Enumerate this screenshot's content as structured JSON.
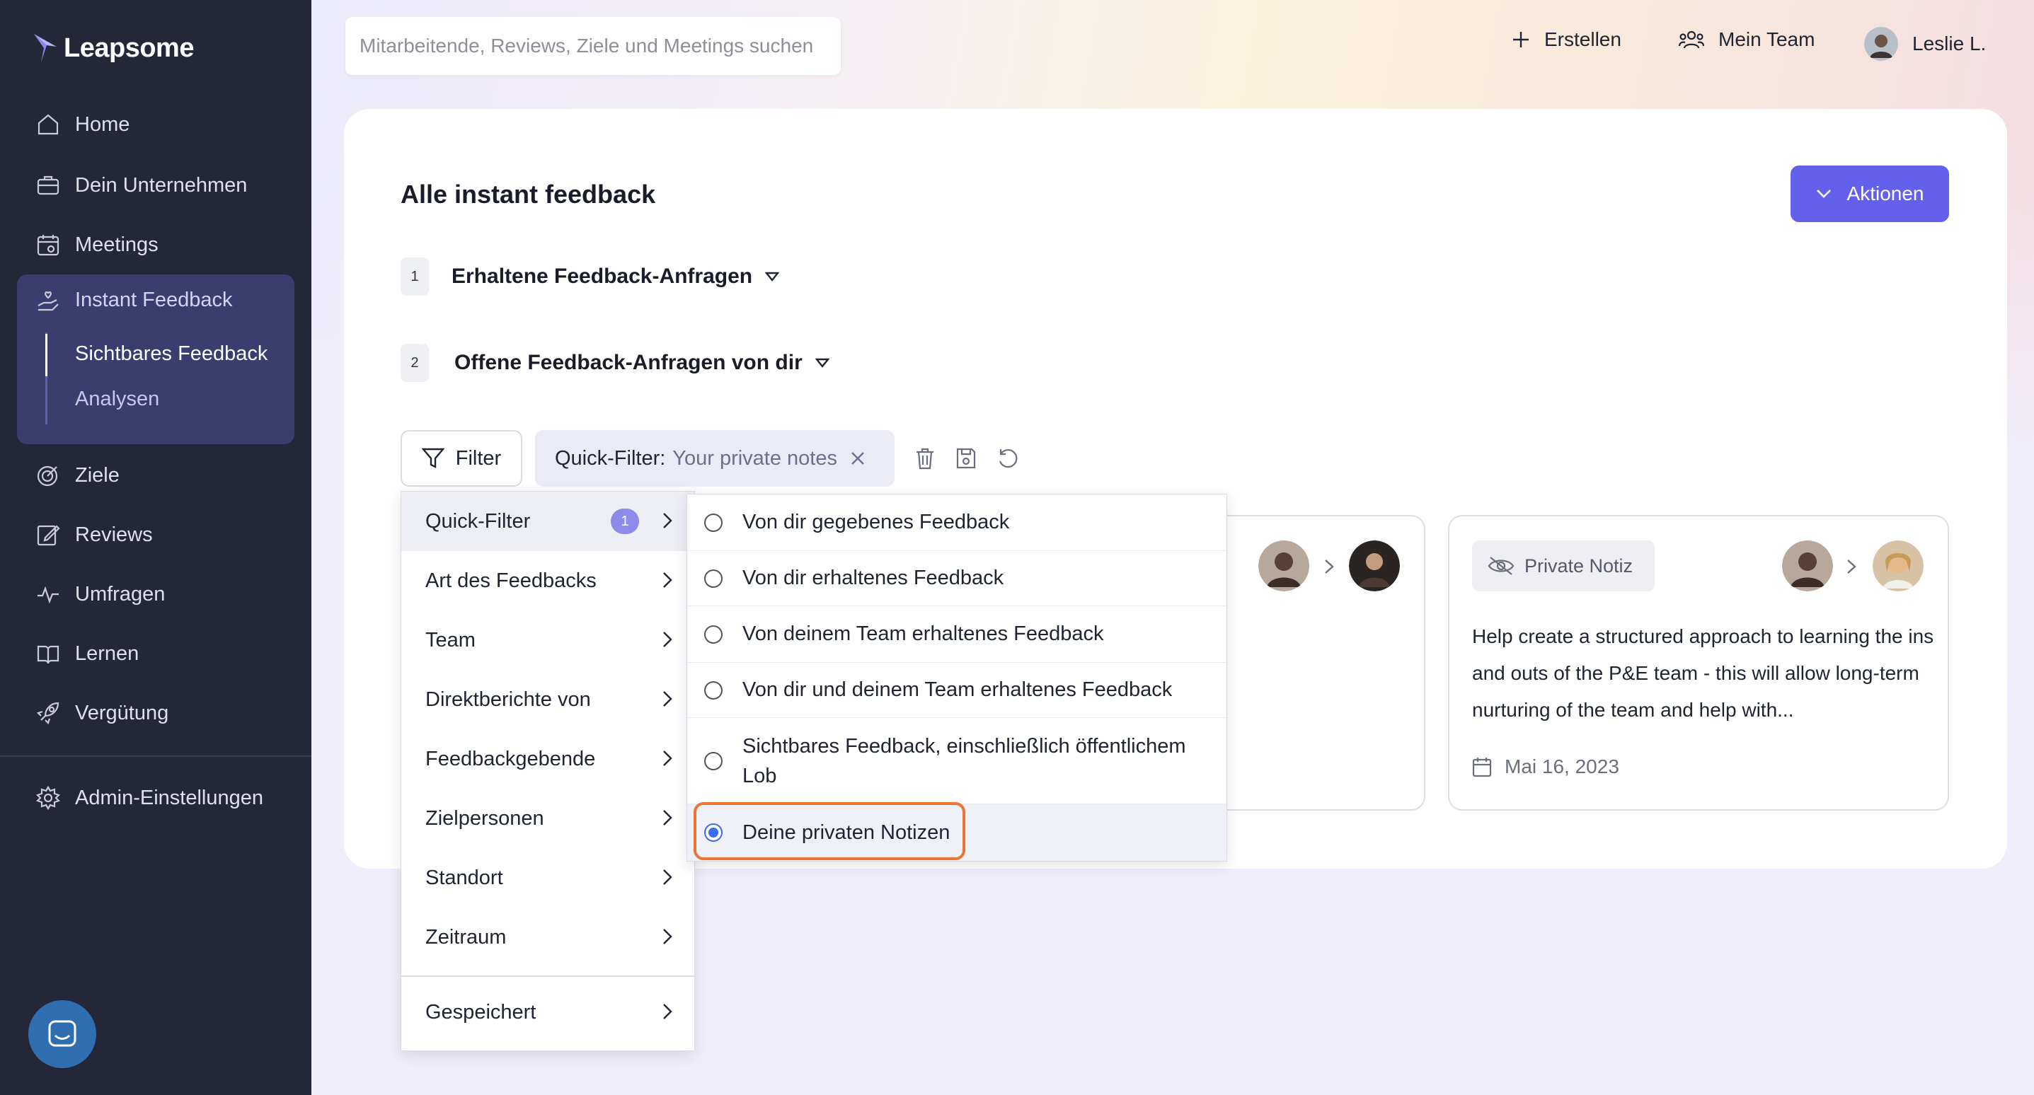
{
  "app": {
    "name": "Leapsome"
  },
  "sidebar": {
    "items": [
      {
        "label": "Home",
        "icon": "home-icon"
      },
      {
        "label": "Dein Unternehmen",
        "icon": "briefcase-icon"
      },
      {
        "label": "Meetings",
        "icon": "calendar-icon"
      },
      {
        "label": "Instant Feedback",
        "icon": "hand-heart-icon"
      },
      {
        "label": "Ziele",
        "icon": "target-icon"
      },
      {
        "label": "Reviews",
        "icon": "edit-icon"
      },
      {
        "label": "Umfragen",
        "icon": "pulse-icon"
      },
      {
        "label": "Lernen",
        "icon": "book-icon"
      },
      {
        "label": "Vergütung",
        "icon": "rocket-icon"
      },
      {
        "label": "Admin-Einstellungen",
        "icon": "gear-icon"
      }
    ],
    "subitems": [
      {
        "label": "Sichtbares Feedback"
      },
      {
        "label": "Analysen"
      }
    ]
  },
  "topbar": {
    "search_placeholder": "Mitarbeitende, Reviews, Ziele und Meetings suchen",
    "create_label": "Erstellen",
    "team_label": "Mein Team",
    "user_label": "Leslie L."
  },
  "page": {
    "title": "Alle instant feedback",
    "actions_label": "Aktionen",
    "sections": [
      {
        "num": "1",
        "label": "Erhaltene Feedback-Anfragen"
      },
      {
        "num": "2",
        "label": "Offene Feedback-Anfragen von dir"
      }
    ]
  },
  "filter": {
    "button_label": "Filter",
    "chip_key": "Quick-Filter:",
    "chip_value": "Your private notes"
  },
  "filter_menu": {
    "items": [
      {
        "label": "Quick-Filter",
        "badge": "1"
      },
      {
        "label": "Art des Feedbacks"
      },
      {
        "label": "Team"
      },
      {
        "label": "Direktberichte von"
      },
      {
        "label": "Feedbackgebende"
      },
      {
        "label": "Zielpersonen"
      },
      {
        "label": "Standort"
      },
      {
        "label": "Zeitraum"
      },
      {
        "label": "Gespeichert"
      }
    ]
  },
  "quick_filter_options": [
    {
      "label": "Von dir gegebenes Feedback",
      "selected": false
    },
    {
      "label": "Von dir erhaltenes Feedback",
      "selected": false
    },
    {
      "label": "Von deinem Team erhaltenes Feedback",
      "selected": false
    },
    {
      "label": "Von dir und deinem Team erhaltenes Feedback",
      "selected": false
    },
    {
      "label": "Sichtbares Feedback, einschließlich öffentlichem Lob",
      "selected": false
    },
    {
      "label": "Deine privaten Notizen",
      "selected": true
    }
  ],
  "feedback_card": {
    "pill_label": "Private Notiz",
    "text": "Help create a structured approach to learning the ins and outs of the P&E team - this will allow long-term nurturing of the team and help with...",
    "date": "Mai 16, 2023"
  },
  "colors": {
    "sidebar_bg": "#232738",
    "accent": "#6360eb",
    "highlight": "#ee7433",
    "radio_on": "#3b6cf0"
  }
}
